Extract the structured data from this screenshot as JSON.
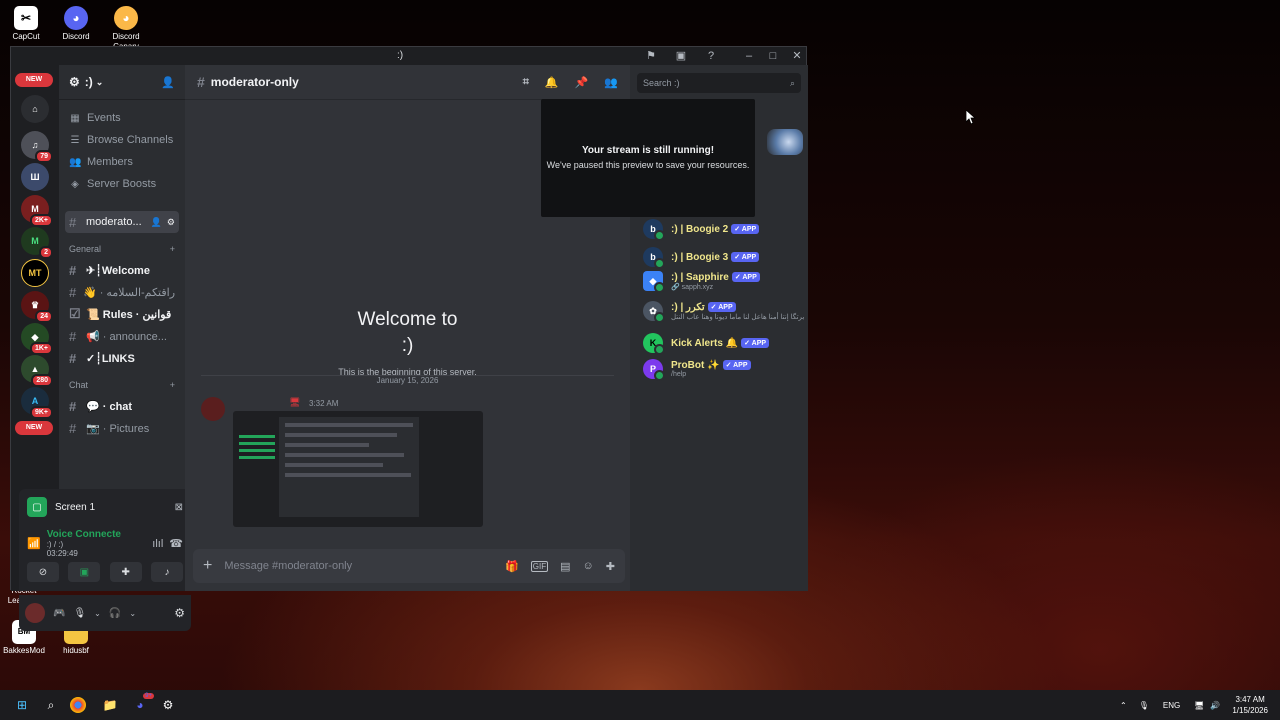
{
  "desktop": {
    "icons": [
      {
        "label": "CapCut"
      },
      {
        "label": "Discord"
      },
      {
        "label": "Discord Canary"
      },
      {
        "label": "Rocket League®"
      },
      {
        "label": "BakkesMod"
      },
      {
        "label": "hidusbf"
      }
    ]
  },
  "window": {
    "title": ":)",
    "rail": {
      "new_label": "NEW",
      "badges": [
        "79",
        "2K+",
        "2",
        "24",
        "1K+",
        "280",
        "9K+"
      ]
    },
    "guild": {
      "name": ":)"
    },
    "nav": [
      {
        "label": "Events",
        "icon": "calendar-icon"
      },
      {
        "label": "Browse Channels",
        "icon": "browse-icon"
      },
      {
        "label": "Members",
        "icon": "members-icon"
      },
      {
        "label": "Server Boosts",
        "icon": "boost-icon"
      }
    ],
    "active_channel": "moderato...",
    "categories": {
      "general": "General",
      "chat": "Chat"
    },
    "channels_general": [
      {
        "label": "✈┊Welcome",
        "bold": true
      },
      {
        "label": "👋 · راقتكم-السلامه",
        "bold": false
      },
      {
        "label": "📜 Rules · قوانين",
        "bold": true
      },
      {
        "label": "📢 · announce...",
        "bold": false
      },
      {
        "label": "✓┊LINKS",
        "bold": true
      }
    ],
    "channels_chat": [
      {
        "label": "💬 · chat",
        "bold": true
      },
      {
        "label": "📷 · Pictures",
        "bold": false
      }
    ],
    "screen_panel": {
      "label": "Screen 1"
    },
    "voice_panel": {
      "status": "Voice Connecte",
      "server": ":) / :)",
      "timer": "03:29:49"
    },
    "header": {
      "channel": "moderator-only"
    },
    "search": {
      "placeholder": "Search :)"
    },
    "welcome": {
      "title_line1": "Welcome to",
      "title_line2": ":)",
      "subtitle": "This is the beginning of this server."
    },
    "date_divider": "January 15, 2026",
    "message": {
      "time": "3:32 AM"
    },
    "composer": {
      "placeholder": "Message #moderator-only"
    },
    "stream_popup": {
      "title": "Your stream is still running!",
      "body": "We've paused this preview to save your resources."
    },
    "members": [
      {
        "name": ":) | Boogie 2",
        "tag": "✓ APP",
        "sub": "",
        "color": "#1e3a5f"
      },
      {
        "name": ":) | Boogie 3",
        "tag": "✓ APP",
        "sub": "",
        "color": "#1e3a5f"
      },
      {
        "name": ":) | Sapphire",
        "tag": "✓ APP",
        "sub": "🔗 sapph.xyz",
        "color": "#3b82f6"
      },
      {
        "name": ":) | تكرر",
        "tag": "✓ APP",
        "sub": "برتگا إنتا أمنا هاعل لنا ماما ديونا وهنا عاب النتل",
        "color": "#4b5563"
      },
      {
        "name": "Kick Alerts 🔔",
        "tag": "✓ APP",
        "sub": "",
        "color": "#22c55e"
      },
      {
        "name": "ProBot ✨",
        "tag": "✓ APP",
        "sub": "/help",
        "color": "#7c3aed"
      }
    ]
  },
  "taskbar": {
    "lang": "ENG",
    "time": "3:47 AM",
    "date": "1/15/2026",
    "badge": "9+"
  }
}
